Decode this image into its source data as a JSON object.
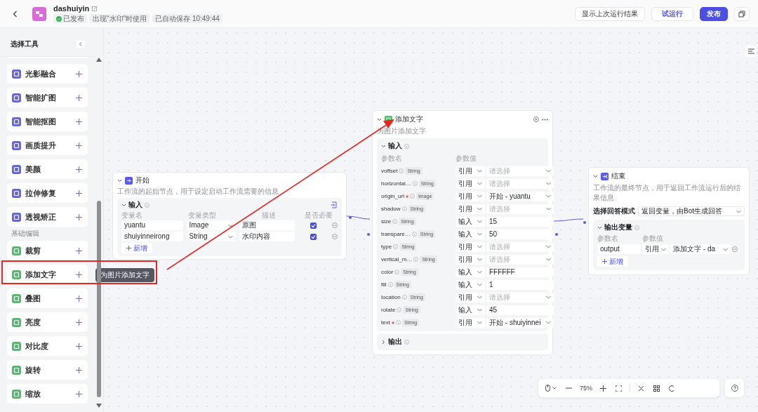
{
  "topbar": {
    "title": "dashuiyin",
    "badges": [
      {
        "text": "已发布",
        "kind": "status"
      },
      {
        "text": "出现\"水印\"时使用",
        "kind": "plain"
      },
      {
        "text": "已自动保存 10:49:44",
        "kind": "plain"
      }
    ],
    "buttons": [
      {
        "label": "显示上次运行结果",
        "kind": "default"
      },
      {
        "label": "试运行",
        "kind": "outline"
      },
      {
        "label": "发布",
        "kind": "primary"
      }
    ]
  },
  "sidebar": {
    "title": "选择工具",
    "groups": [
      {
        "color": "#6466e9",
        "items": [
          {
            "label": "光影融合"
          },
          {
            "label": "智能扩图"
          },
          {
            "label": "智能抠图"
          },
          {
            "label": "画质提升"
          },
          {
            "label": "美颜"
          },
          {
            "label": "拉伸修复"
          },
          {
            "label": "透视矫正"
          }
        ]
      },
      {
        "heading": "基础编辑",
        "color": "#4cbf6a",
        "items": [
          {
            "label": "裁剪"
          },
          {
            "label": "添加文字",
            "tooltip": "为图片添加文字"
          },
          {
            "label": "叠图"
          },
          {
            "label": "亮度"
          },
          {
            "label": "对比度"
          },
          {
            "label": "旋转"
          },
          {
            "label": "缩放"
          }
        ]
      }
    ]
  },
  "start_node": {
    "title": "开始",
    "description": "工作流的起始节点，用于设定启动工作流需要的信息",
    "section": "输入",
    "columns": [
      "变量名",
      "变量类型",
      "描述",
      "是否必要"
    ],
    "rows": [
      {
        "name": "yuantu",
        "type": "Image",
        "description": "原图",
        "required": true
      },
      {
        "name": "shuiyinneirong",
        "type": "String",
        "description": "水印内容",
        "required": true
      }
    ],
    "add_label": "新增"
  },
  "add_text_node": {
    "title": "添加文字",
    "description": "为图片添加文字",
    "section": "输入",
    "columns": [
      "参数名",
      "参数值"
    ],
    "params": [
      {
        "name": "voffset",
        "required": false,
        "type": "String",
        "source": "引用",
        "kind": "reference",
        "placeholder": "请选择"
      },
      {
        "name": "horizontal…",
        "required": false,
        "type": "String",
        "source": "引用",
        "kind": "reference",
        "placeholder": "请选择"
      },
      {
        "name": "origin_url",
        "required": true,
        "type": "Image",
        "source": "引用",
        "kind": "reference",
        "value": "开始 - yuantu"
      },
      {
        "name": "shadow",
        "required": false,
        "type": "String",
        "source": "引用",
        "kind": "reference",
        "placeholder": "请选择"
      },
      {
        "name": "size",
        "required": false,
        "type": "String",
        "source": "输入",
        "kind": "input",
        "value": "15"
      },
      {
        "name": "transpare…",
        "required": false,
        "type": "String",
        "source": "输入",
        "kind": "input",
        "value": "50"
      },
      {
        "name": "type",
        "required": false,
        "type": "String",
        "source": "引用",
        "kind": "reference",
        "placeholder": "请选择"
      },
      {
        "name": "vertical_m…",
        "required": false,
        "type": "String",
        "source": "引用",
        "kind": "reference",
        "placeholder": "请选择"
      },
      {
        "name": "color",
        "required": false,
        "type": "String",
        "source": "输入",
        "kind": "input",
        "value": "FFFFFF"
      },
      {
        "name": "fill",
        "required": false,
        "type": "String",
        "source": "输入",
        "kind": "input",
        "value": "1"
      },
      {
        "name": "location",
        "required": false,
        "type": "String",
        "source": "引用",
        "kind": "reference",
        "placeholder": "请选择"
      },
      {
        "name": "rotate",
        "required": false,
        "type": "String",
        "source": "输入",
        "kind": "input",
        "value": "45"
      },
      {
        "name": "text",
        "required": true,
        "type": "String",
        "source": "引用",
        "kind": "reference",
        "value": "开始 - shuiyinnei"
      }
    ],
    "output": {
      "label": "输出",
      "expanded": false
    }
  },
  "end_node": {
    "title": "结束",
    "description": "工作流的最终节点，用于返回工作流运行后的结果信息",
    "mode_label": "选择回答模式",
    "mode_value": "返回变量，由Bot生成回答",
    "section": "输出变量",
    "columns": [
      "参数名",
      "参数值"
    ],
    "rows": [
      {
        "name": "output",
        "source": "引用",
        "value": "添加文字 - da"
      }
    ],
    "add_label": "新增"
  },
  "zoom_toolbar": {
    "zoom": "75%"
  }
}
